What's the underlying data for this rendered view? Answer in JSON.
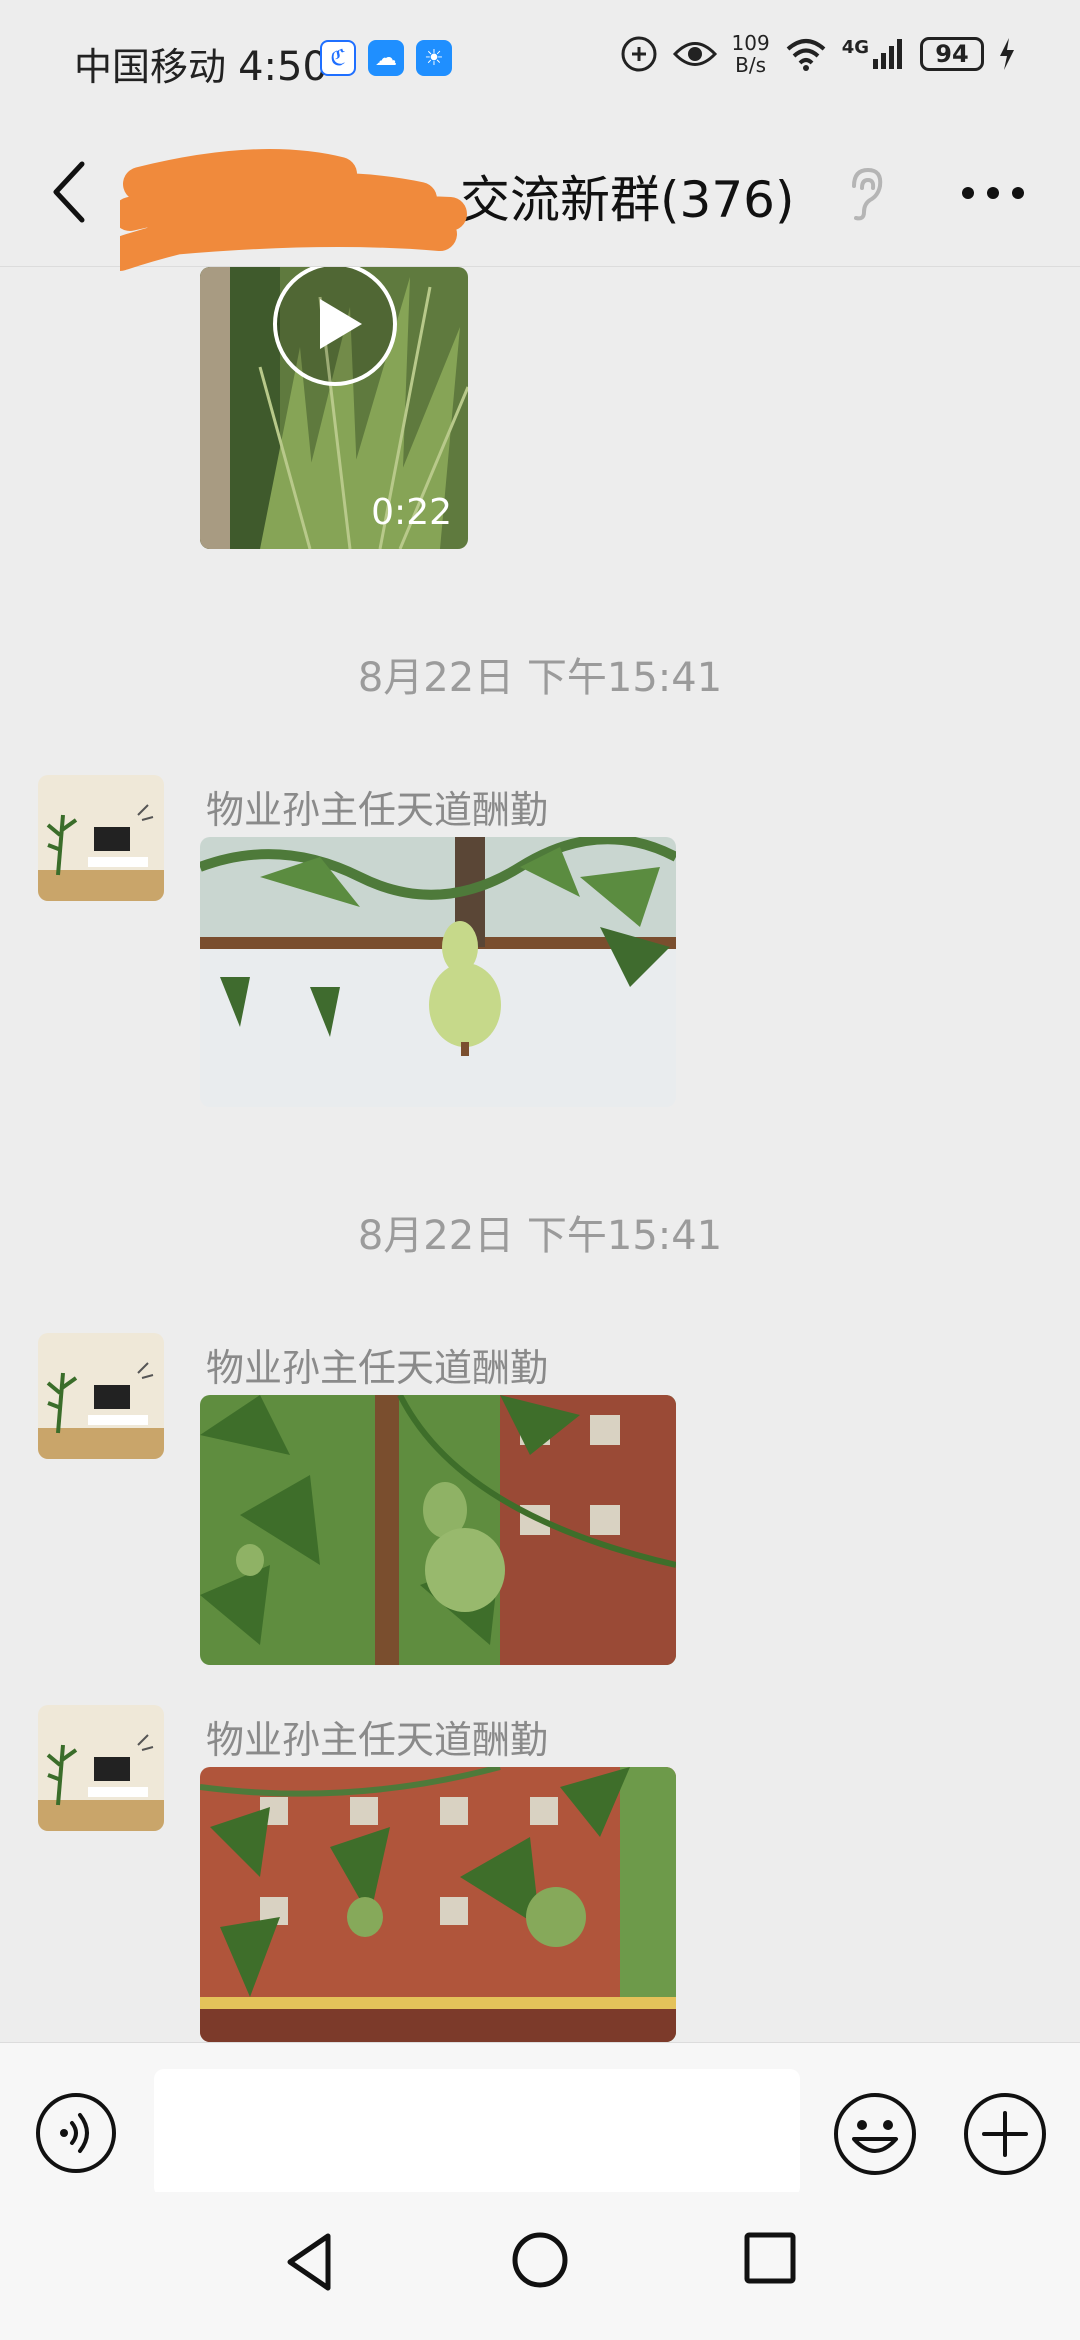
{
  "status_bar": {
    "carrier": "中国移动",
    "time": "4:50",
    "net_speed_value": "109",
    "net_speed_unit": "B/s",
    "network": "4G",
    "battery": "94"
  },
  "header": {
    "title": "交流新群(376)"
  },
  "messages": [
    {
      "type": "video",
      "duration": "0:22"
    },
    {
      "type": "timestamp",
      "text": "8月22日 下午15:41"
    },
    {
      "type": "image",
      "sender": "物业孙主任天道酬勤"
    },
    {
      "type": "timestamp",
      "text": "8月22日 下午15:41"
    },
    {
      "type": "image",
      "sender": "物业孙主任天道酬勤"
    },
    {
      "type": "image",
      "sender": "物业孙主任天道酬勤"
    }
  ],
  "colors": {
    "background": "#ededed",
    "redaction": "#f08a3c",
    "timestamp": "#9b9b9b"
  },
  "icons": [
    "back-icon",
    "ear-icon",
    "more-icon",
    "play-icon",
    "voice-icon",
    "emoji-icon",
    "plus-icon",
    "nav-back-icon",
    "nav-home-icon",
    "nav-recent-icon"
  ]
}
